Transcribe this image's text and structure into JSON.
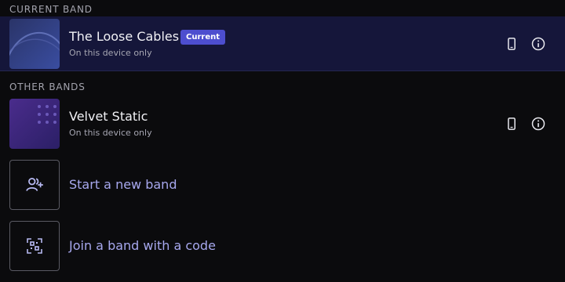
{
  "sections": {
    "current_label": "CURRENT BAND",
    "other_label": "OTHER BANDS"
  },
  "current_band": {
    "name": "The Loose Cables",
    "badge": "Current",
    "subtitle": "On this device only",
    "device_icon": "phone-icon",
    "info_icon": "info-icon"
  },
  "other_bands": [
    {
      "name": "Velvet Static",
      "subtitle": "On this device only",
      "device_icon": "phone-icon",
      "info_icon": "info-icon"
    }
  ],
  "actions": {
    "new_band": {
      "label": "Start a new band",
      "icon": "add-person-icon"
    },
    "join_band": {
      "label": "Join a band with a code",
      "icon": "qr-code-scan-icon"
    }
  },
  "colors": {
    "background": "#0b0b0d",
    "current_row": "#15163a",
    "accent": "#4d4ecf",
    "action_text": "#a7a8ee"
  }
}
